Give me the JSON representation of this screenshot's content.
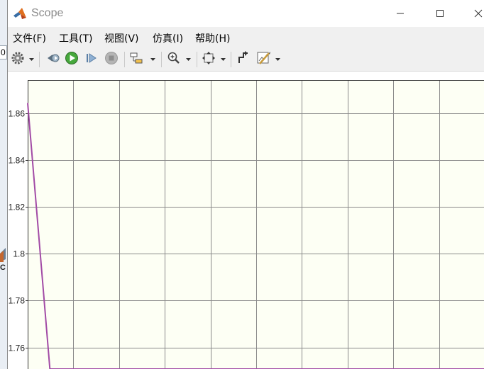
{
  "background_window": {
    "field_text": "0",
    "block_label": "C"
  },
  "window": {
    "title": "Scope",
    "icon": "matlab-icon"
  },
  "menu": {
    "items": [
      "文件(F)",
      "工具(T)",
      "视图(V)",
      "仿真(I)",
      "帮助(H)"
    ]
  },
  "toolbar": {
    "icons": [
      "gear-icon",
      "step-back-icon",
      "run-icon",
      "step-forward-icon",
      "stop-icon",
      "highlight-block-icon",
      "zoom-icon",
      "autoscale-icon",
      "cursor-measure-icon",
      "style-icon"
    ]
  },
  "colors": {
    "signal": "#a24ba6",
    "plot_background": "#fdfff4",
    "grid": "#8a8a8a"
  },
  "chart_data": {
    "type": "line",
    "title": "",
    "xlabel": "",
    "ylabel": "",
    "ylim": [
      1.7508,
      1.8741
    ],
    "yticks": [
      1.76,
      1.78,
      1.8,
      1.82,
      1.84,
      1.86
    ],
    "ytick_labels": [
      "1.76",
      "1.78",
      "1.8",
      "1.82",
      "1.84",
      "1.86"
    ],
    "grid": true,
    "series": [
      {
        "x": [
          0,
          0.0486,
          1.0
        ],
        "y": [
          1.8643,
          1.7508,
          1.7508
        ]
      }
    ]
  }
}
